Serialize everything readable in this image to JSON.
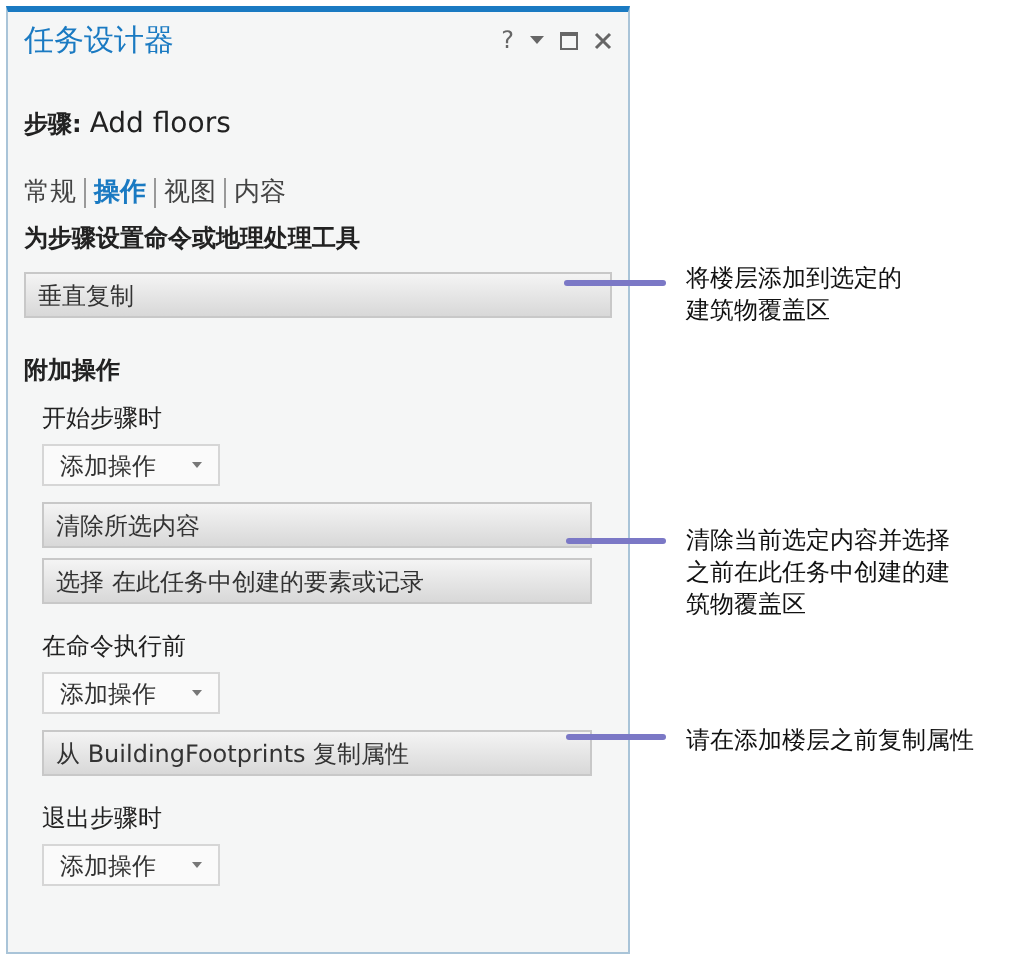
{
  "panel": {
    "title": "任务设计器",
    "help": "?",
    "step_label": "步骤:",
    "step_name": "Add floors",
    "tabs": [
      {
        "label": "常规",
        "selected": false
      },
      {
        "label": "操作",
        "selected": true
      },
      {
        "label": "视图",
        "selected": false
      },
      {
        "label": "内容",
        "selected": false
      }
    ],
    "command_heading": "为步骤设置命令或地理处理工具",
    "command": "垂直复制",
    "additional_heading": "附加操作",
    "groups": [
      {
        "label": "开始步骤时",
        "add_button": "添加操作",
        "actions": [
          "清除所选内容",
          "选择 在此任务中创建的要素或记录"
        ]
      },
      {
        "label": "在命令执行前",
        "add_button": "添加操作",
        "actions": [
          "从 BuildingFootprints 复制属性"
        ]
      },
      {
        "label": "退出步骤时",
        "add_button": "添加操作"
      }
    ]
  },
  "callouts": [
    {
      "text": "将楼层添加到选定的建筑物覆盖区"
    },
    {
      "text": "清除当前选定内容并选择之前在此任务中创建的建筑物覆盖区"
    },
    {
      "text": "请在添加楼层之前复制属性"
    }
  ]
}
